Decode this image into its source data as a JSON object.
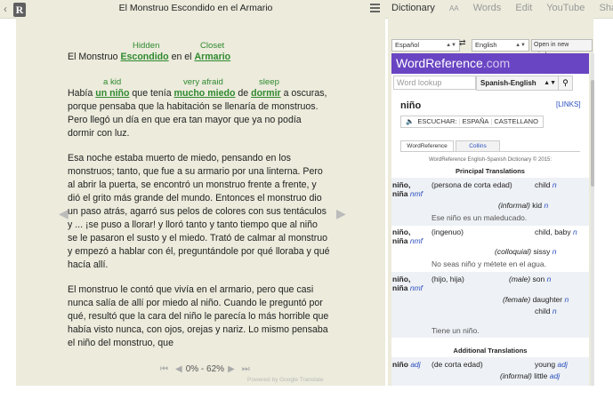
{
  "reader": {
    "title": "El Monstruo Escondido en el Armario",
    "title_line": {
      "pre": "El Monstruo ",
      "w1": "Escondido",
      "mid": " en el ",
      "w2": "Armario",
      "g1": "Hidden",
      "g2": "Closet"
    },
    "p1": {
      "pre": "Había ",
      "w1": "un niño",
      "mid1": " que tenía ",
      "w2": "mucho miedo",
      "mid2": " de ",
      "w3": "dormir",
      "post": " a oscuras, porque pensaba que la habitación se llenaría de monstruos. Pero llegó un día en que era tan mayor que ya no podía dormir con luz.",
      "g1": "a kid",
      "g2": "very afraid",
      "g3": "sleep"
    },
    "p2": "Esa noche estaba muerto de miedo, pensando en los monstruos; tanto, que fue a su armario por una linterna. Pero al abrir la puerta, se encontró un monstruo frente a frente, y dió el grito más grande del mundo. Entonces el monstruo dio un paso atrás, agarró sus pelos de colores con sus tentáculos y ... ¡se puso a llorar! y lloró tanto y tanto tiempo que al niño se le pasaron el susto y el miedo. Trató de calmar al monstruo y empezó a hablar con él, preguntándole por qué lloraba y qué hacía allí.",
    "p3": "El monstruo le contó que vivía en el armario, pero que casi nunca salía de allí por miedo al niño. Cuando le preguntó por qué, resultó que la cara del niño le parecía lo más horrible que había visto nunca, con ojos, orejas y nariz. Lo mismo pensaba el niño del monstruo, que",
    "progress": "0% - 62%",
    "powered": "Powered by Google Translate"
  },
  "tabs": [
    "Dictionary",
    "AA",
    "Words",
    "Edit",
    "YouTube",
    "Share"
  ],
  "lang": {
    "from": "Español",
    "to": "English",
    "new_window": "Open in new window",
    "swap": "⇄"
  },
  "wr": {
    "brand": "WordReference",
    "brand_suffix": ".com",
    "lookup_placeholder": "Word lookup",
    "dict": "Spanish-English",
    "headword": "niño",
    "links": "[LINKS]",
    "audio": [
      "ESCUCHAR:",
      "ESPAÑA",
      "CASTELLANO"
    ],
    "tab1": "WordReference",
    "tab2": "Collins",
    "copyright": "WordReference English-Spanish Dictionary © 2015:",
    "principal": "Principal Translations",
    "additional": "Additional Translations",
    "e1": {
      "hw": "niño,",
      "hw2": "niña",
      "pos": "nmf",
      "def": "(persona de corta edad)",
      "t1": "child",
      "t1p": "n",
      "note": "(informal)",
      "t2": "kid",
      "t2p": "n",
      "ex": "Ese niño es un maleducado."
    },
    "e2": {
      "hw": "niño,",
      "hw2": "niña",
      "pos": "nmf",
      "def": "(ingenuo)",
      "t1": "child, baby",
      "t1p": "n",
      "note": "(colloquial)",
      "t2": "sissy",
      "t2p": "n",
      "ex": "No seas niño y métete en el agua."
    },
    "e3": {
      "hw": "niño,",
      "hw2": "niña",
      "pos": "nmf",
      "def": "(hijo, hija)",
      "note1": "(male)",
      "t1": "son",
      "t1p": "n",
      "note2": "(female)",
      "t2": "daughter",
      "t2p": "n",
      "t3": "child",
      "t3p": "n",
      "ex": "Tiene un niño."
    },
    "e4": {
      "hw": "niño",
      "pos": "adj",
      "def": "(de corta edad)",
      "t1": "young",
      "t1p": "adj",
      "note": "(informal)",
      "t2": "little",
      "t2p": "adj"
    }
  }
}
